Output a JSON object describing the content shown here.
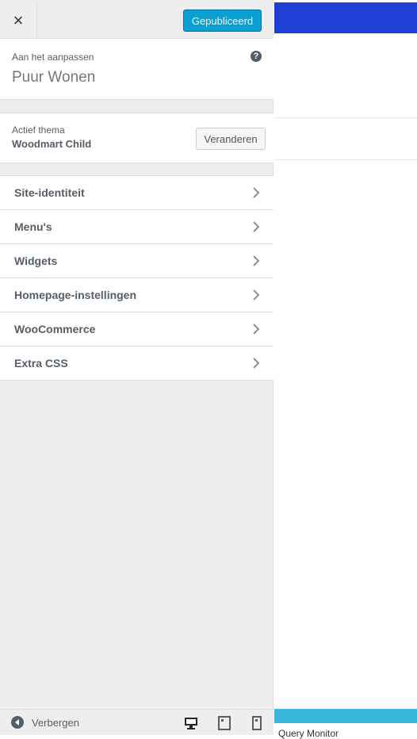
{
  "header": {
    "close_label": "×",
    "publish_label": "Gepubliceerd"
  },
  "info": {
    "label": "Aan het aanpassen",
    "title": "Puur Wonen",
    "help_glyph": "?"
  },
  "theme": {
    "label": "Actief thema",
    "name": "Woodmart Child",
    "change_label": "Veranderen"
  },
  "nav": {
    "items": [
      {
        "label": "Site-identiteit"
      },
      {
        "label": "Menu's"
      },
      {
        "label": "Widgets"
      },
      {
        "label": "Homepage-instellingen"
      },
      {
        "label": "WooCommerce"
      },
      {
        "label": "Extra CSS"
      }
    ]
  },
  "footer": {
    "hide_label": "Verbergen"
  },
  "preview": {
    "query_monitor": "Query Monitor"
  },
  "colors": {
    "primary_button": "#0ba0d2",
    "preview_header": "#1e3fd6",
    "preview_footer": "#3bb6dd",
    "sidebar_bg": "#eeeeee"
  },
  "icons": [
    "close-icon",
    "help-icon",
    "chevron-right-icon",
    "collapse-icon",
    "desktop-icon",
    "tablet-icon",
    "mobile-icon"
  ]
}
